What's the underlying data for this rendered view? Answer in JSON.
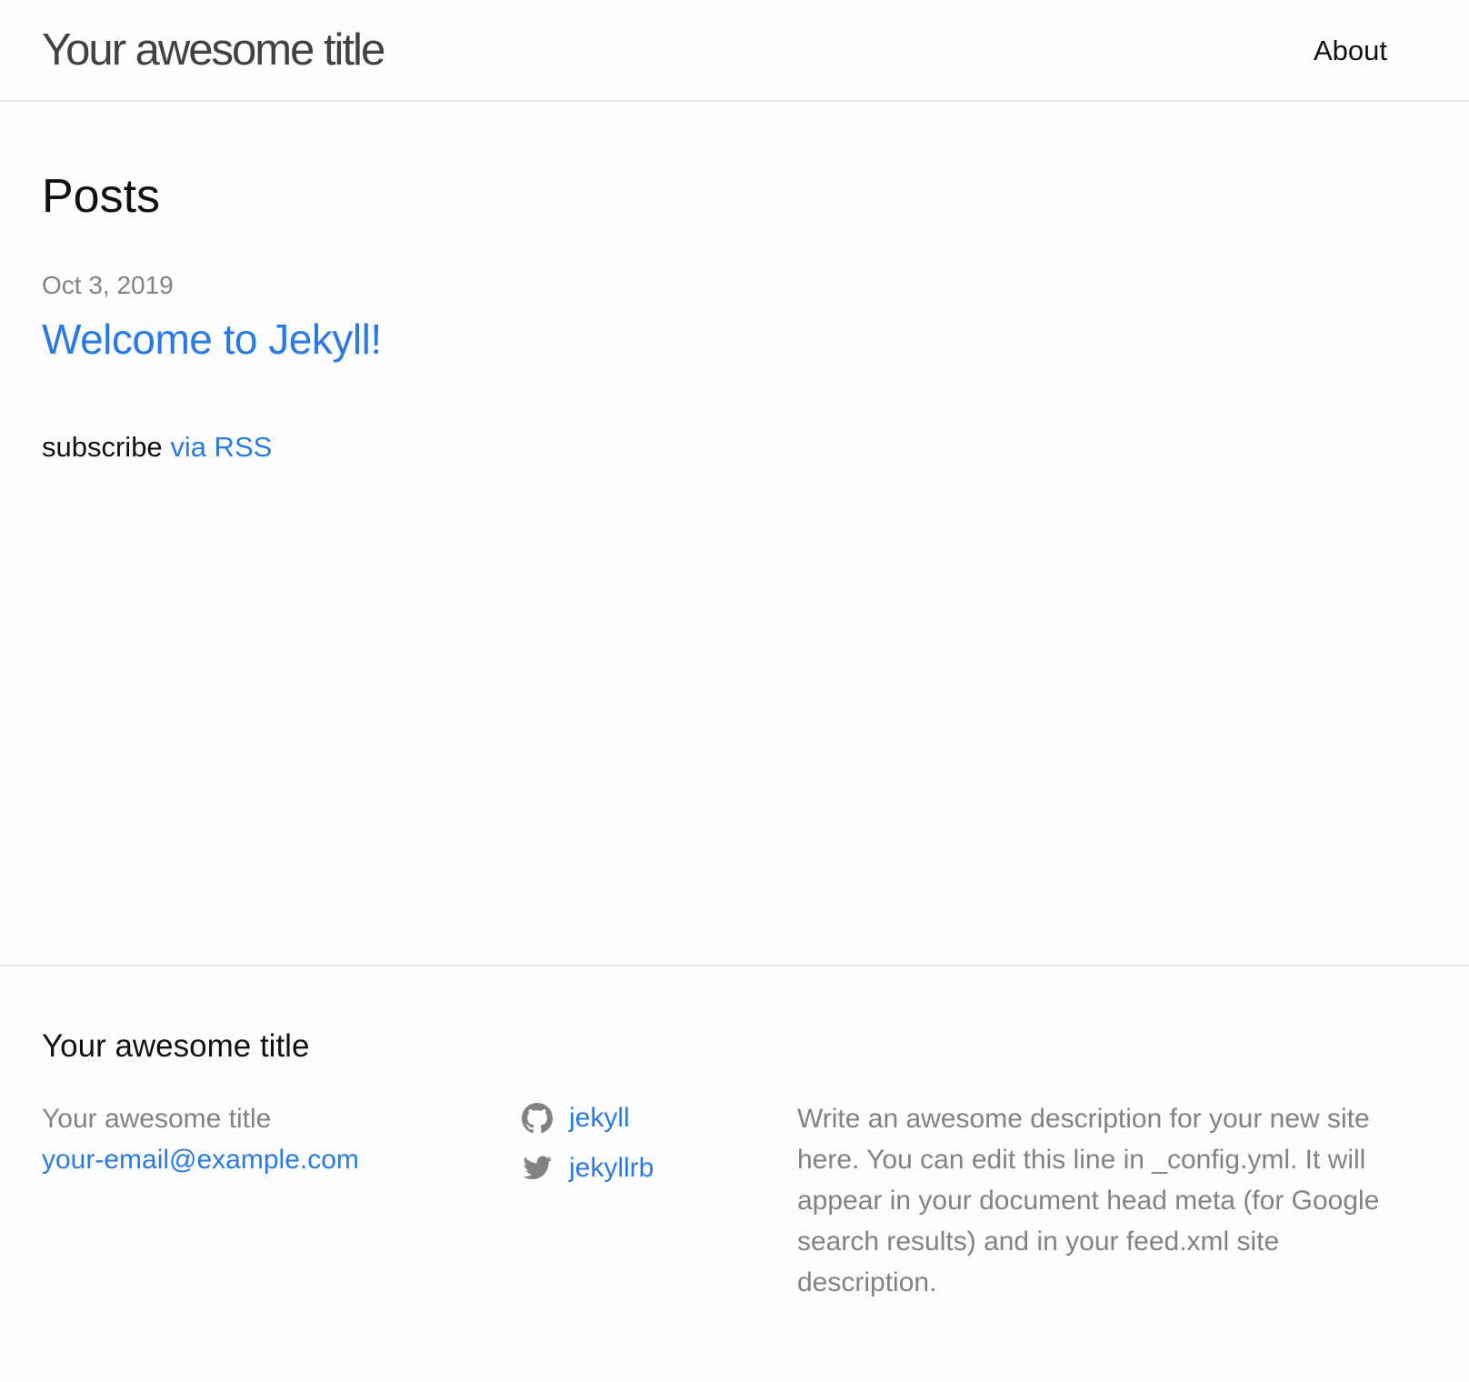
{
  "header": {
    "site_title": "Your awesome title",
    "nav": [
      {
        "label": "About"
      }
    ]
  },
  "main": {
    "page_heading": "Posts",
    "posts": [
      {
        "date": "Oct 3, 2019",
        "title": "Welcome to Jekyll!"
      }
    ],
    "rss": {
      "prefix": "subscribe",
      "link_label": "via RSS"
    }
  },
  "footer": {
    "heading": "Your awesome title",
    "contact": {
      "name": "Your awesome title",
      "email": "your-email@example.com"
    },
    "social": [
      {
        "icon": "github-icon",
        "label": "jekyll"
      },
      {
        "icon": "twitter-icon",
        "label": "jekyllrb"
      }
    ],
    "description": "Write an awesome description for your new site here. You can edit this line in _config.yml. It will appear in your document head meta (for Google search results) and in your feed.xml site description."
  },
  "colors": {
    "link": "#2a7ae2",
    "meta_text": "#828282",
    "text": "#111111",
    "title": "#424242",
    "border": "#e8e8e8",
    "background": "#fdfdfd"
  }
}
